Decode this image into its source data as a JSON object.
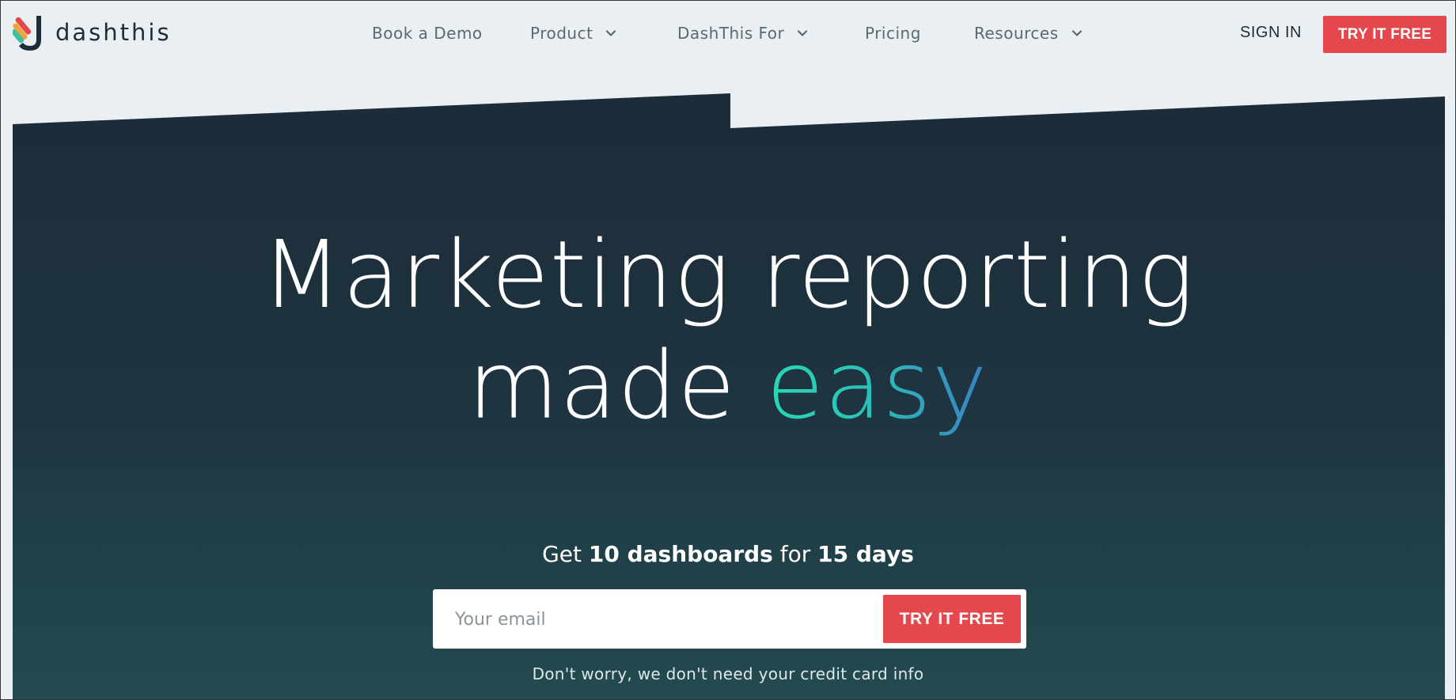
{
  "brand": {
    "name": "dashthis"
  },
  "nav": {
    "book_demo": "Book a Demo",
    "product": "Product",
    "dashthis_for": "DashThis For",
    "pricing": "Pricing",
    "resources": "Resources",
    "sign_in": "SIGN IN",
    "try_free": "TRY IT FREE"
  },
  "hero": {
    "headline_line1": "Marketing reporting",
    "headline_line2_prefix": "made ",
    "headline_line2_highlight": "easy",
    "offer_prefix": "Get ",
    "offer_dashboards": "10 dashboards",
    "offer_middle": " for ",
    "offer_days": "15 days",
    "email_placeholder": "Your email",
    "try_free": "TRY IT FREE",
    "note": "Don't worry, we don't need your credit card info"
  },
  "colors": {
    "accent": "#e4484d",
    "hero_top": "#1c2c38",
    "hero_bottom": "#224a4f",
    "easy_start": "#28d8b6",
    "easy_end": "#3a7fc2"
  },
  "icons": [
    "logo-mark-icon",
    "chevron-down-icon"
  ]
}
